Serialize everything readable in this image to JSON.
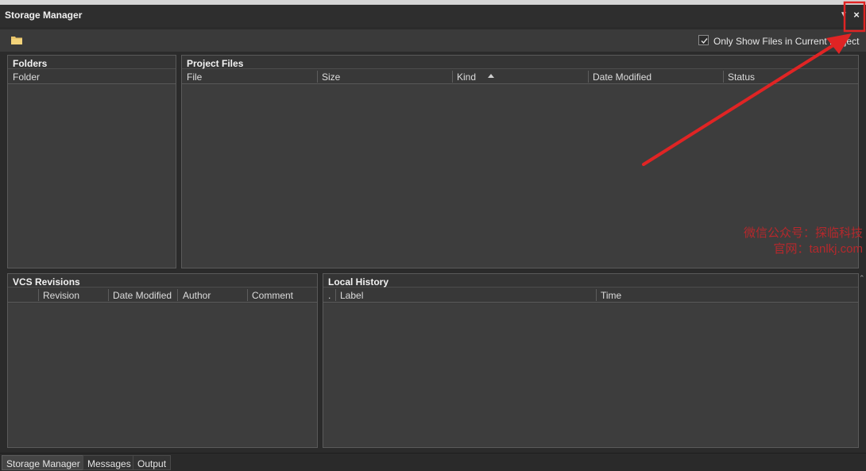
{
  "window": {
    "title": "Storage Manager",
    "menu_glyph": "▼",
    "close_glyph": "×"
  },
  "toolbar": {
    "folder_icon": "folder-icon",
    "only_show_label": "Only Show Files in Current Project",
    "only_show_checked": true
  },
  "folders_panel": {
    "title": "Folders",
    "columns": [
      "Folder"
    ]
  },
  "project_files_panel": {
    "title": "Project Files",
    "columns": [
      "File",
      "Size",
      "Kind",
      "Date Modified",
      "Status"
    ],
    "sort_column": "File"
  },
  "vcs_panel": {
    "title": "VCS Revisions",
    "columns": [
      "",
      "Revision",
      "Date Modified",
      "Author",
      "Comment"
    ]
  },
  "local_history_panel": {
    "title": "Local History",
    "columns": [
      ".",
      "Label",
      "Time"
    ]
  },
  "watermark": {
    "line1": "微信公众号：探临科技",
    "line2": "官网：tanlkj.com"
  },
  "bottom_tabs": [
    {
      "label": "Storage Manager",
      "active": true
    },
    {
      "label": "Messages",
      "active": false
    },
    {
      "label": "Output",
      "active": false
    }
  ],
  "colors": {
    "background": "#2b2b2b",
    "panel": "#3b3b3b",
    "annotation_red": "#e02424"
  }
}
